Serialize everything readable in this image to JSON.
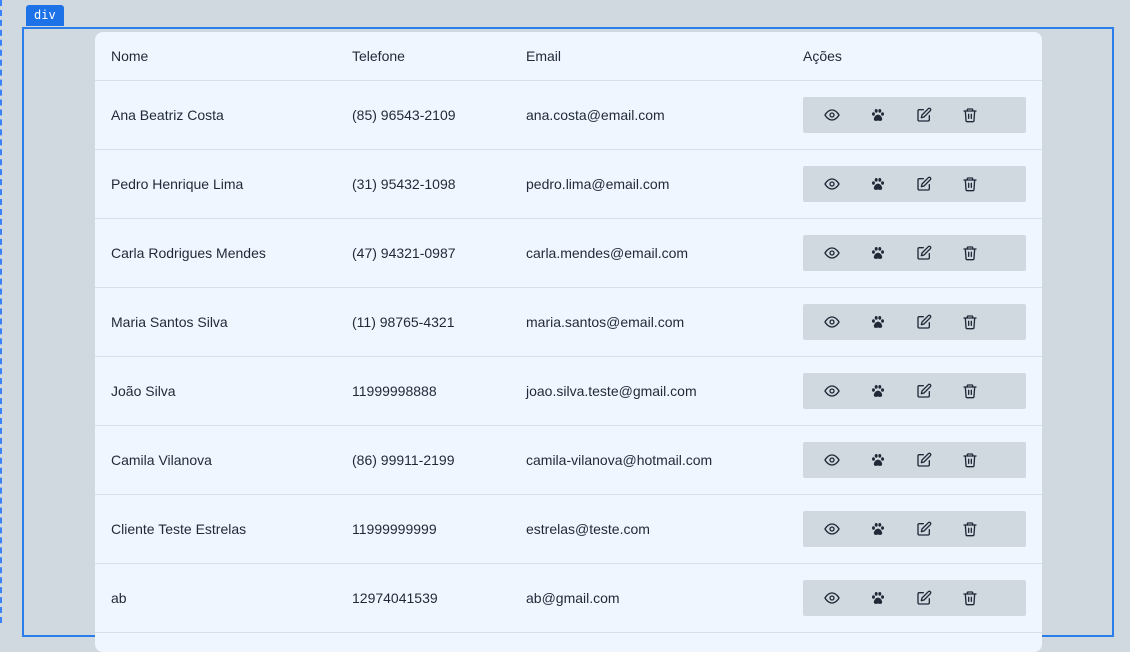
{
  "devtools": {
    "tag_label": "div"
  },
  "table": {
    "headers": {
      "nome": "Nome",
      "telefone": "Telefone",
      "email": "Email",
      "acoes": "Ações"
    },
    "rows": [
      {
        "nome": "Ana Beatriz Costa",
        "telefone": "(85) 96543-2109",
        "email": "ana.costa@email.com"
      },
      {
        "nome": "Pedro Henrique Lima",
        "telefone": "(31) 95432-1098",
        "email": "pedro.lima@email.com"
      },
      {
        "nome": "Carla Rodrigues Mendes",
        "telefone": "(47) 94321-0987",
        "email": "carla.mendes@email.com"
      },
      {
        "nome": "Maria Santos Silva",
        "telefone": "(11) 98765-4321",
        "email": "maria.santos@email.com"
      },
      {
        "nome": "João Silva",
        "telefone": "11999998888",
        "email": "joao.silva.teste@gmail.com"
      },
      {
        "nome": "Camila Vilanova",
        "telefone": "(86) 99911-2199",
        "email": "camila-vilanova@hotmail.com"
      },
      {
        "nome": "Cliente Teste Estrelas",
        "telefone": "11999999999",
        "email": "estrelas@teste.com"
      },
      {
        "nome": "ab",
        "telefone": "12974041539",
        "email": "ab@gmail.com"
      }
    ],
    "row_actions": [
      {
        "name": "view",
        "icon": "eye-icon"
      },
      {
        "name": "pets",
        "icon": "paw-icon"
      },
      {
        "name": "edit",
        "icon": "edit-icon"
      },
      {
        "name": "delete",
        "icon": "trash-icon"
      }
    ]
  },
  "colors": {
    "page_bg": "#d1d9e0",
    "card_bg": "#eff6ff",
    "devtools_accent": "#2b7de9",
    "actions_bg": "#d1d9e0"
  }
}
